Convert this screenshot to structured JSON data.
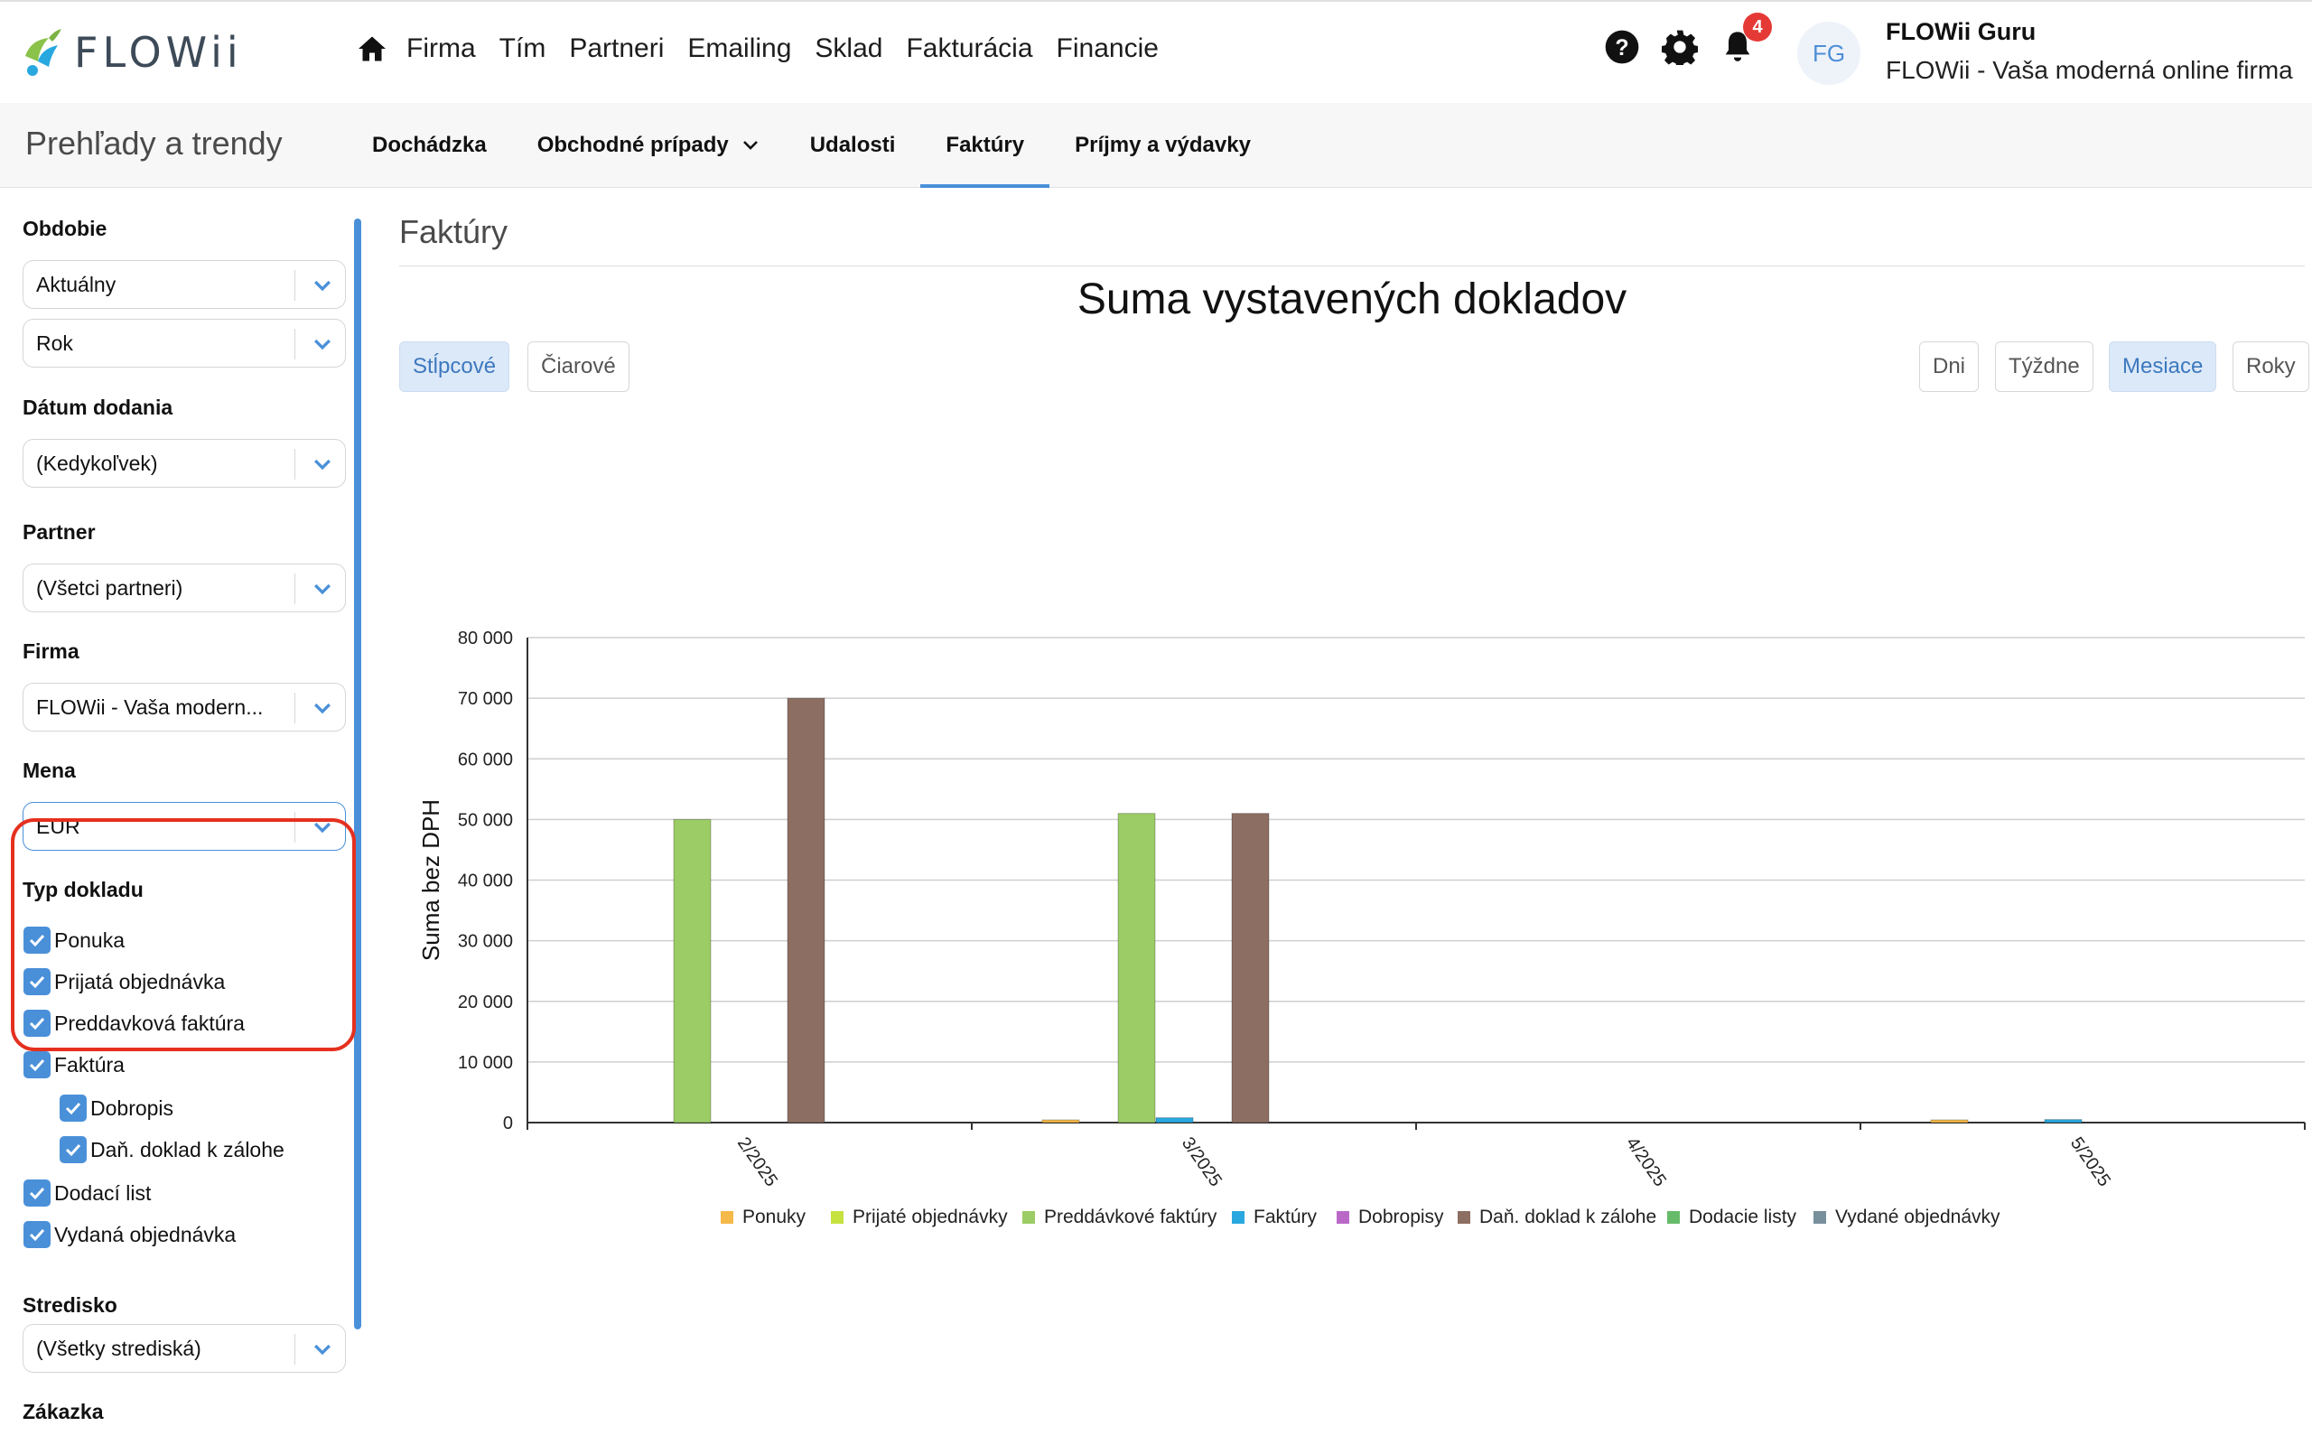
{
  "brand": {
    "name": "FLOWii"
  },
  "nav": {
    "items": [
      "Firma",
      "Tím",
      "Partneri",
      "Emailing",
      "Sklad",
      "Fakturácia",
      "Financie"
    ]
  },
  "notifications": {
    "count": "4"
  },
  "user": {
    "initials": "FG",
    "name": "FLOWii Guru",
    "firm": "FLOWii - Vaša moderná online firma"
  },
  "subnav": {
    "title": "Prehľady a trendy",
    "tabs": [
      "Dochádzka",
      "Obchodné prípady",
      "Udalosti",
      "Faktúry",
      "Príjmy a výdavky"
    ],
    "active_tab": "Faktúry"
  },
  "filters": {
    "period_label": "Obdobie",
    "period_value": "Aktuálny",
    "period_unit": "Rok",
    "delivery_label": "Dátum dodania",
    "delivery_value": "(Kedykoľvek)",
    "partner_label": "Partner",
    "partner_value": "(Všetci partneri)",
    "firm_label": "Firma",
    "firm_value": "FLOWii - Vaša modern...",
    "currency_label": "Mena",
    "currency_value": "EUR",
    "doctype_label": "Typ dokladu",
    "doctypes": [
      "Ponuka",
      "Prijatá objednávka",
      "Preddavková faktúra",
      "Faktúra",
      "Dobropis",
      "Daň. doklad k zálohe",
      "Dodací list",
      "Vydaná objednávka"
    ],
    "center_label": "Stredisko",
    "center_value": "(Všetky strediská)",
    "order_label": "Zákazka"
  },
  "content": {
    "title": "Faktúry",
    "chart_title": "Suma vystavených dokladov",
    "chart_types": [
      "Stĺpcové",
      "Čiarové"
    ],
    "active_chart_type": "Stĺpcové",
    "granularity": [
      "Dni",
      "Týždne",
      "Mesiace",
      "Roky"
    ],
    "active_granularity": "Mesiace"
  },
  "chart_data": {
    "type": "bar",
    "title": "Suma vystavených dokladov",
    "ylabel": "Suma bez DPH",
    "xlabel": "",
    "ylim": [
      0,
      80000
    ],
    "yticks": [
      "0",
      "10 000",
      "20 000",
      "30 000",
      "40 000",
      "50 000",
      "60 000",
      "70 000",
      "80 000"
    ],
    "categories": [
      "2/2025",
      "3/2025",
      "4/2025",
      "5/2025"
    ],
    "legend_position": "bottom",
    "grid": true,
    "series": [
      {
        "name": "Ponuky",
        "color": "#f5b94a",
        "values": [
          0,
          200,
          0,
          200
        ]
      },
      {
        "name": "Prijaté objednávky",
        "color": "#c5e23f",
        "values": [
          0,
          0,
          0,
          0
        ]
      },
      {
        "name": "Preddávkové faktúry",
        "color": "#9ccc65",
        "values": [
          50000,
          51000,
          0,
          0
        ]
      },
      {
        "name": "Faktúry",
        "color": "#29a8e0",
        "values": [
          0,
          800,
          0,
          500
        ]
      },
      {
        "name": "Dobropisy",
        "color": "#ba68c8",
        "values": [
          0,
          0,
          0,
          0
        ]
      },
      {
        "name": "Daň. doklad k zálohe",
        "color": "#8d6e63",
        "values": [
          70000,
          51000,
          0,
          0
        ]
      },
      {
        "name": "Dodacie listy",
        "color": "#66bb6a",
        "values": [
          0,
          0,
          0,
          0
        ]
      },
      {
        "name": "Vydané objednávky",
        "color": "#78909c",
        "values": [
          0,
          0,
          0,
          0
        ]
      }
    ]
  }
}
